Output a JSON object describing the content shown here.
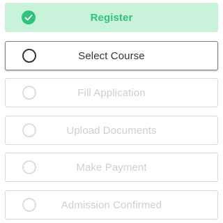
{
  "steps": [
    {
      "label": "Register",
      "state": "completed",
      "icon": "check-icon"
    },
    {
      "label": "Select Course",
      "state": "active",
      "icon": "radio-circle-icon"
    },
    {
      "label": "Fill Application",
      "state": "pending",
      "icon": "radio-circle-icon"
    },
    {
      "label": "Upload Documents",
      "state": "pending",
      "icon": "radio-circle-icon"
    },
    {
      "label": "Make Payment",
      "state": "pending",
      "icon": "radio-circle-icon"
    },
    {
      "label": "Admission Confirmed",
      "state": "pending",
      "icon": "radio-circle-icon"
    }
  ],
  "colors": {
    "success": "#2fc27a",
    "success_bg": "#c9f2db",
    "active_text": "#333333",
    "pending_text": "#cfcfcf"
  }
}
